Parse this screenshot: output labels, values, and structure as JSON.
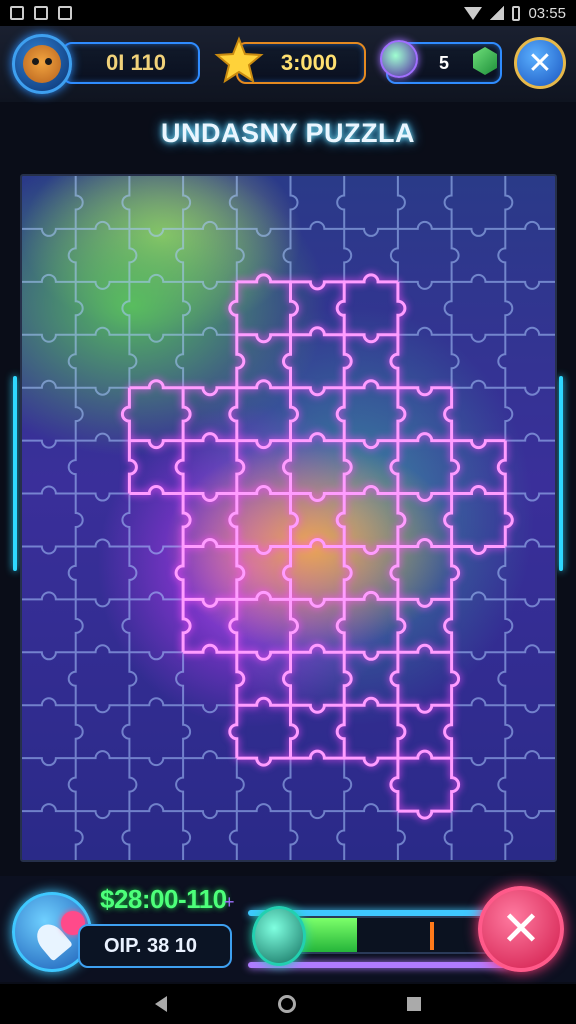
{
  "status_bar": {
    "time": "03:55"
  },
  "hud": {
    "score": "0I 110",
    "timer": "3:000",
    "gems": "5",
    "close_label": "✕"
  },
  "title": "UNDASNY PUZZLA",
  "bottom": {
    "money": "$28:00-110",
    "money_plus": "+",
    "sub_value": "OIP. 38 10",
    "progress_fraction": 0.38,
    "close_label": "✕"
  },
  "board": {
    "columns": 10,
    "rows": 13
  }
}
